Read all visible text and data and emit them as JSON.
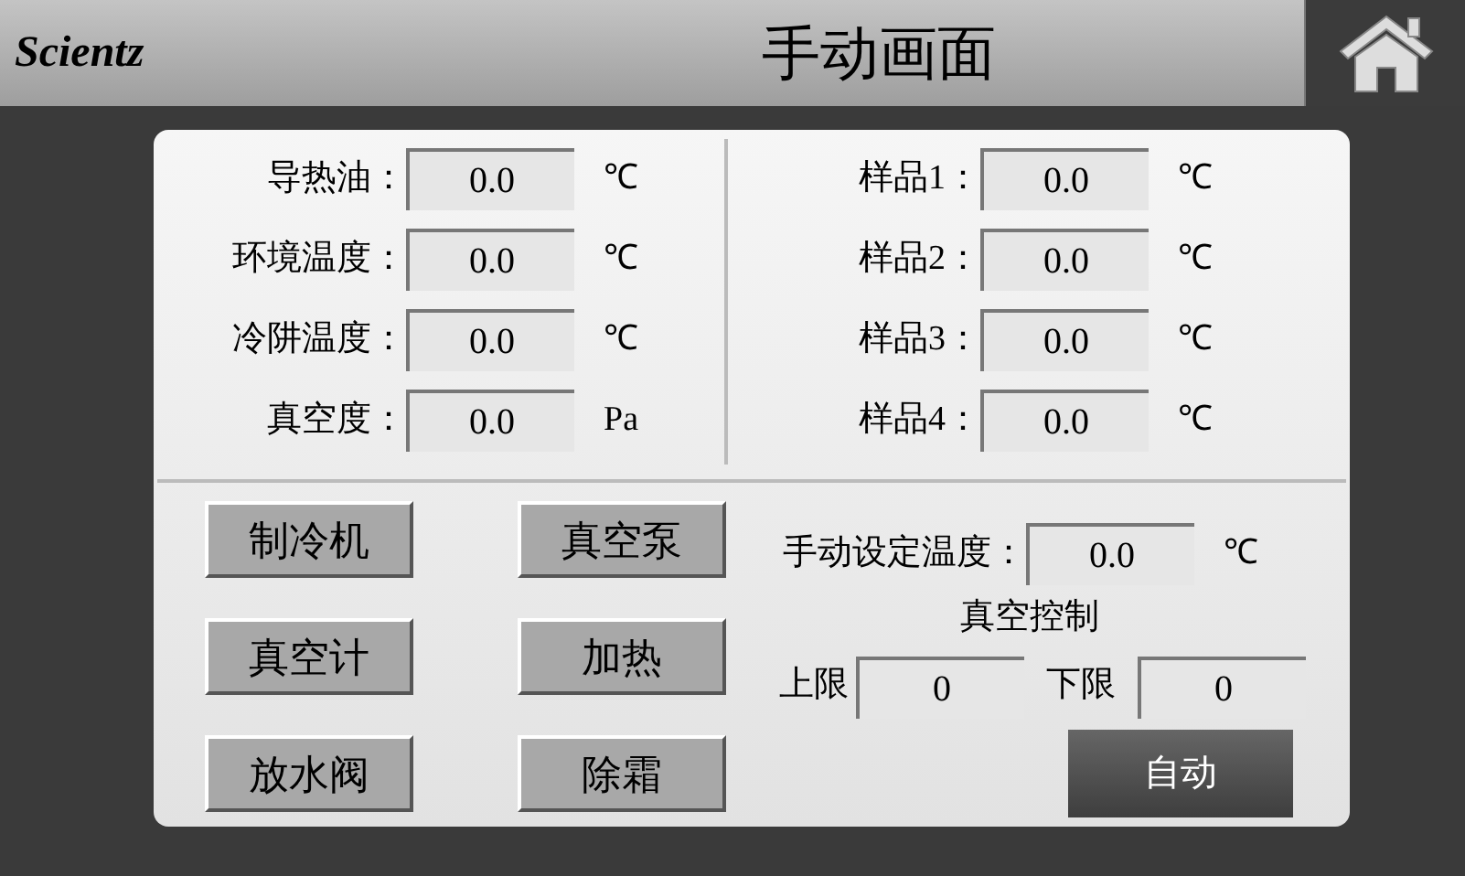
{
  "header": {
    "logo": "Scientz",
    "title": "手动画面"
  },
  "readings_left": [
    {
      "label": "导热油：",
      "value": "0.0",
      "unit": "℃"
    },
    {
      "label": "环境温度：",
      "value": "0.0",
      "unit": "℃"
    },
    {
      "label": "冷阱温度：",
      "value": "0.0",
      "unit": "℃"
    },
    {
      "label": "真空度：",
      "value": "0.0",
      "unit": "Pa"
    }
  ],
  "readings_right": [
    {
      "label": "样品1：",
      "value": "0.0",
      "unit": "℃"
    },
    {
      "label": "样品2：",
      "value": "0.0",
      "unit": "℃"
    },
    {
      "label": "样品3：",
      "value": "0.0",
      "unit": "℃"
    },
    {
      "label": "样品4：",
      "value": "0.0",
      "unit": "℃"
    }
  ],
  "buttons": [
    [
      "制冷机",
      "真空泵"
    ],
    [
      "真空计",
      "加热"
    ],
    [
      "放水阀",
      "除霜"
    ]
  ],
  "set_temperature": {
    "label": "手动设定温度：",
    "value": "0.0",
    "unit": "℃"
  },
  "vacuum_control": {
    "title": "真空控制",
    "upper_label": "上限",
    "upper_value": "0",
    "lower_label": "下限",
    "lower_value": "0",
    "mode_button": "自动"
  }
}
